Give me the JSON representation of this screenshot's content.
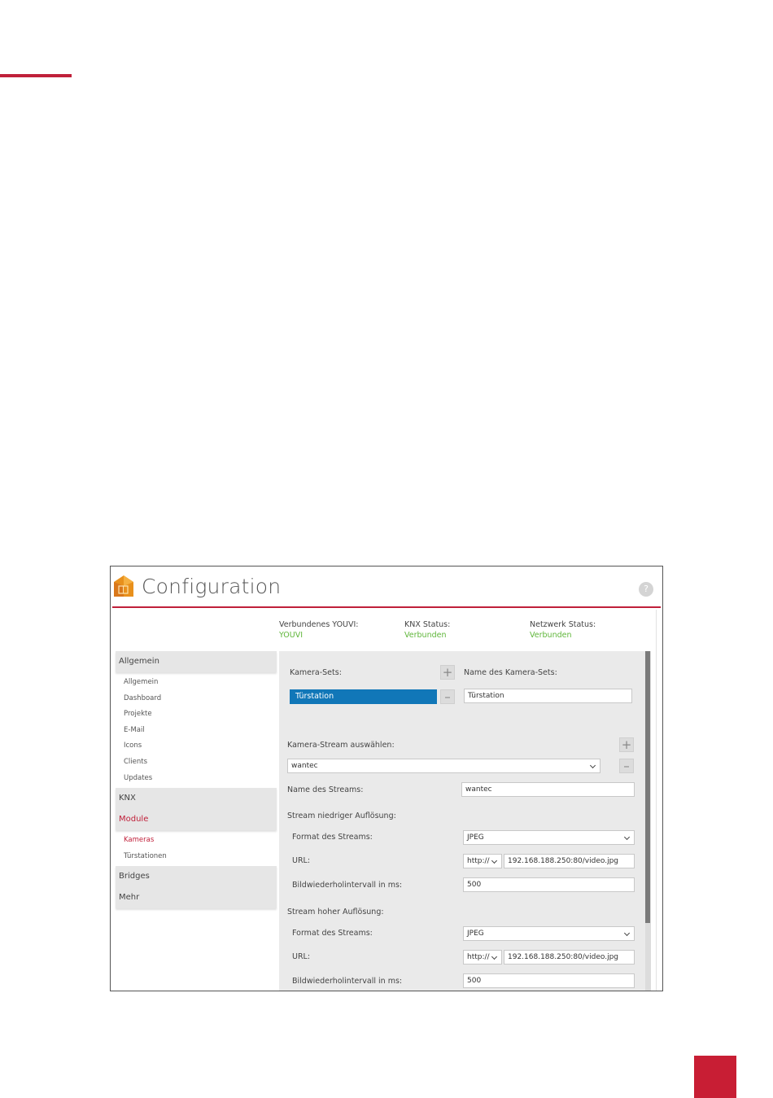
{
  "app": {
    "title": "Configuration",
    "help_glyph": "?",
    "icons": {
      "logo": "house-logo-icon",
      "help": "help-icon",
      "add": "plus-icon",
      "remove": "minus-icon",
      "dropdown": "chevron-down-icon"
    }
  },
  "status": [
    {
      "label": "Verbundenes YOUVI:",
      "value": "YOUVI"
    },
    {
      "label": "KNX Status:",
      "value": "Verbunden"
    },
    {
      "label": "Netzwerk Status:",
      "value": "Verbunden"
    }
  ],
  "sidebar": {
    "sections": [
      {
        "label": "Allgemein",
        "items": [
          "Allgemein",
          "Dashboard",
          "Projekte",
          "E-Mail",
          "Icons",
          "Clients",
          "Updates"
        ]
      },
      {
        "label": "KNX"
      },
      {
        "label": "Module",
        "active": true,
        "items": [
          "Kameras",
          "Türstationen"
        ]
      },
      {
        "label": "Bridges"
      },
      {
        "label": "Mehr"
      }
    ]
  },
  "camera_sets": {
    "label": "Kamera-Sets:",
    "selected": "Türstation",
    "name_label": "Name des Kamera-Sets:",
    "name_value": "Türstation"
  },
  "stream": {
    "select_label": "Kamera-Stream auswählen:",
    "selected": "wantec",
    "name_label": "Name des Streams:",
    "name_value": "wantec"
  },
  "low_res": {
    "heading": "Stream niedriger Auflösung:",
    "format_label": "Format des Streams:",
    "format_value": "JPEG",
    "url_label": "URL:",
    "protocol": "http://",
    "url_value": "192.168.188.250:80/video.jpg",
    "interval_label": "Bildwiederholintervall in ms:",
    "interval_value": "500"
  },
  "high_res": {
    "heading": "Stream hoher Auflösung:",
    "format_label": "Format des Streams:",
    "format_value": "JPEG",
    "url_label": "URL:",
    "protocol": "http://",
    "url_value": "192.168.188.250:80/video.jpg",
    "interval_label": "Bildwiederholintervall in ms:",
    "interval_value": "500"
  },
  "colors": {
    "accent_red": "#c0203a",
    "status_green": "#5fb63a",
    "selection_blue": "#1177b8"
  }
}
